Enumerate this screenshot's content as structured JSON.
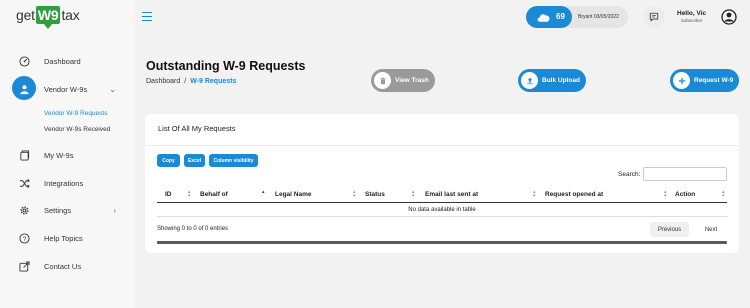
{
  "logo": {
    "pre": "get",
    "mid": "W9",
    "post": "tax"
  },
  "sidebar": {
    "items": [
      {
        "label": "Dashboard",
        "icon": "dashboard-icon"
      },
      {
        "label": "Vendor W-9s",
        "icon": "vendor-icon"
      },
      {
        "label": "My W-9s",
        "icon": "files-icon"
      },
      {
        "label": "Integrations",
        "icon": "integrations-icon"
      },
      {
        "label": "Settings",
        "icon": "gear-icon"
      },
      {
        "label": "Help Topics",
        "icon": "help-icon"
      },
      {
        "label": "Contact Us",
        "icon": "contact-icon"
      }
    ],
    "sub_items": [
      {
        "label": "Vendor W-9 Requests"
      },
      {
        "label": "Vendor W-9s Received"
      }
    ]
  },
  "header": {
    "credits": "69",
    "account_info": "Bryant 03/05/2022",
    "greeting": "Hello, Vic",
    "role": "Subscriber"
  },
  "page": {
    "title": "Outstanding W-9 Requests",
    "breadcrumb_home": "Dashboard",
    "breadcrumb_sep": "/",
    "breadcrumb_current": "W-9 Requests"
  },
  "actions": {
    "trash": "View Trash",
    "bulk": "Bulk Upload",
    "request": "Request W-9"
  },
  "card": {
    "title": "List Of All My Requests",
    "buttons": [
      "Copy",
      "Excel",
      "Column visibility"
    ],
    "search_label": "Search:",
    "search_value": "",
    "columns": [
      "ID",
      "Behalf of",
      "Legal Name",
      "Status",
      "Email last sent at",
      "Request opened at",
      "Action"
    ],
    "empty": "No data available in table",
    "info": "Showing 0 to 0 of 0 entries",
    "prev": "Previous",
    "next": "Next"
  },
  "colors": {
    "accent": "#1b8ad6",
    "brand": "#2e9e3f",
    "muted": "#9a9a9a"
  }
}
